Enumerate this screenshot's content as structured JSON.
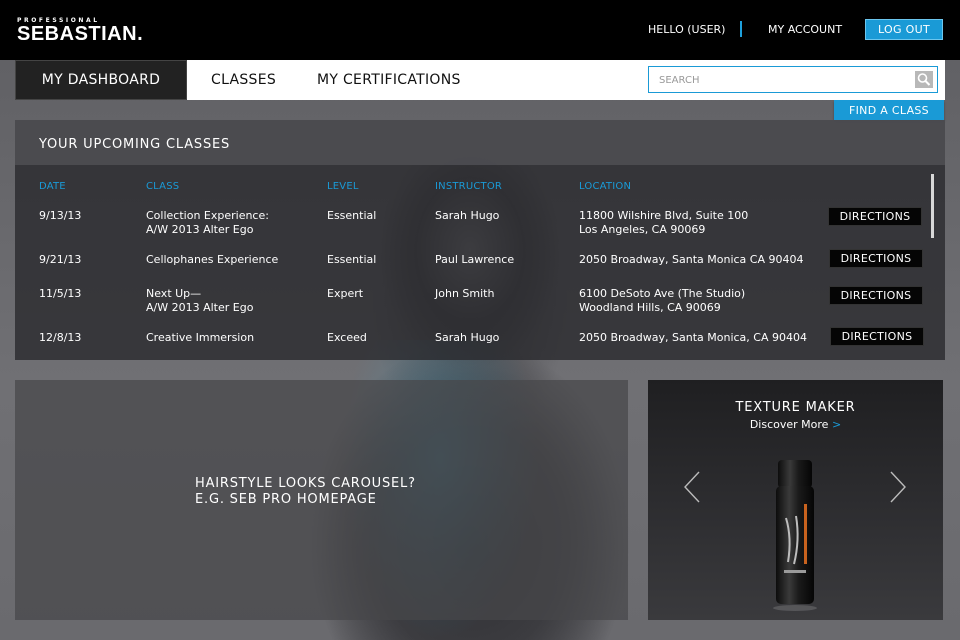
{
  "header": {
    "logo_small": "PROFESSIONAL",
    "logo_main": "SEBASTIAN.",
    "greeting": "HELLO (USER)",
    "account_link": "MY ACCOUNT",
    "logout_label": "LOG OUT"
  },
  "nav": {
    "tabs": [
      {
        "label": "MY DASHBOARD",
        "active": true
      },
      {
        "label": "CLASSES",
        "active": false
      },
      {
        "label": "MY CERTIFICATIONS",
        "active": false
      }
    ],
    "search_placeholder": "SEARCH",
    "find_class_label": "FIND A CLASS"
  },
  "upcoming": {
    "title": "YOUR UPCOMING CLASSES",
    "columns": [
      "DATE",
      "CLASS",
      "LEVEL",
      "INSTRUCTOR",
      "LOCATION"
    ],
    "directions_label": "DIRECTIONS",
    "rows": [
      {
        "date": "9/13/13",
        "class_line1": "Collection Experience:",
        "class_line2": "A/W 2013 Alter Ego",
        "level": "Essential",
        "instructor": "Sarah Hugo",
        "loc_line1": "11800 Wilshire Blvd, Suite 100",
        "loc_line2": "Los Angeles, CA 90069"
      },
      {
        "date": "9/21/13",
        "class_line1": "Cellophanes Experience",
        "class_line2": "",
        "level": "Essential",
        "instructor": "Paul Lawrence",
        "loc_line1": "2050 Broadway, Santa Monica CA 90404",
        "loc_line2": ""
      },
      {
        "date": "11/5/13",
        "class_line1": "Next Up—",
        "class_line2": "A/W 2013 Alter Ego",
        "level": "Expert",
        "instructor": "John Smith",
        "loc_line1": "6100 DeSoto Ave (The Studio)",
        "loc_line2": "Woodland Hills, CA 90069"
      },
      {
        "date": "12/8/13",
        "class_line1": "Creative Immersion",
        "class_line2": "",
        "level": "Exceed",
        "instructor": "Sarah Hugo",
        "loc_line1": "2050 Broadway, Santa Monica, CA 90404",
        "loc_line2": ""
      }
    ]
  },
  "carousel": {
    "line1": "HAIRSTYLE LOOKS CAROUSEL?",
    "line2": "E.G. SEB PRO HOMEPAGE"
  },
  "product": {
    "title": "TEXTURE MAKER",
    "subtitle": "Discover More",
    "subtitle_chevron": ">"
  },
  "colors": {
    "accent": "#1a9ad6",
    "header_bg": "#000000"
  }
}
